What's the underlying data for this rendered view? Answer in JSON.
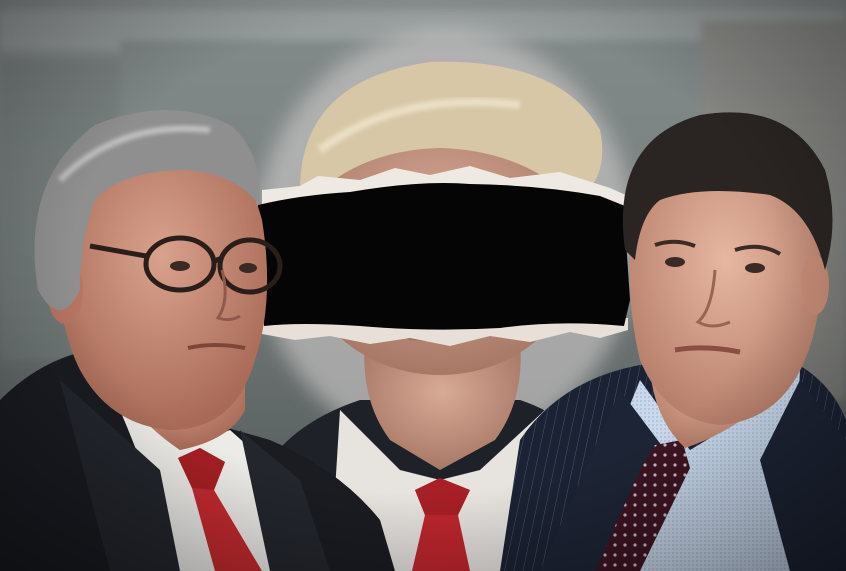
{
  "image": {
    "alt": "",
    "subjects": [
      {
        "id": "left-man",
        "description": ""
      },
      {
        "id": "center-man",
        "description": ""
      },
      {
        "id": "right-man",
        "description": ""
      }
    ]
  },
  "palette": {
    "background_top": "#8a9190",
    "background_bottom": "#4e5655",
    "skin_left": "#c98f7a",
    "skin_center": "#c99a86",
    "skin_right": "#d9a893",
    "hair_left": "#8b8b8b",
    "hair_center": "#d8c9a8",
    "hair_right": "#2b2624",
    "suit_dark": "#1a1c22",
    "shirt_white": "#e9e8e6",
    "shirt_blue": "#c7d7ea",
    "tie_red": "#c0262e",
    "tie_maroon": "#4a1a2a",
    "censor_bar": "#050505"
  }
}
